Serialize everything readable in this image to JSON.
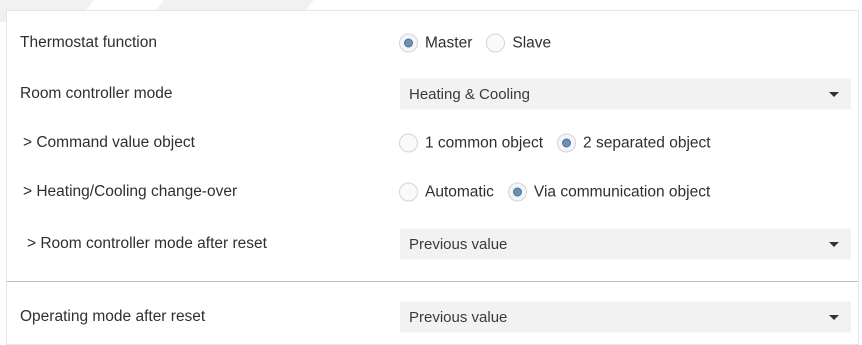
{
  "rows": [
    {
      "label": "Thermostat function",
      "options": [
        {
          "label": "Master",
          "selected": true
        },
        {
          "label": "Slave",
          "selected": false
        }
      ]
    },
    {
      "label": "Room controller mode",
      "value": "Heating & Cooling"
    },
    {
      "label": "> Command value object",
      "options": [
        {
          "label": "1 common object",
          "selected": false
        },
        {
          "label": "2 separated object",
          "selected": true
        }
      ]
    },
    {
      "label": "> Heating/Cooling change-over",
      "options": [
        {
          "label": "Automatic",
          "selected": false
        },
        {
          "label": "Via communication object",
          "selected": true
        }
      ]
    },
    {
      "label": "> Room controller mode after reset",
      "value": "Previous value"
    },
    {
      "label": "Operating mode after reset",
      "value": "Previous value"
    }
  ],
  "colors": {
    "radio_selected": "#6d8fb6",
    "select_bg": "#f2f2f2",
    "divider": "#bdbdbd"
  }
}
